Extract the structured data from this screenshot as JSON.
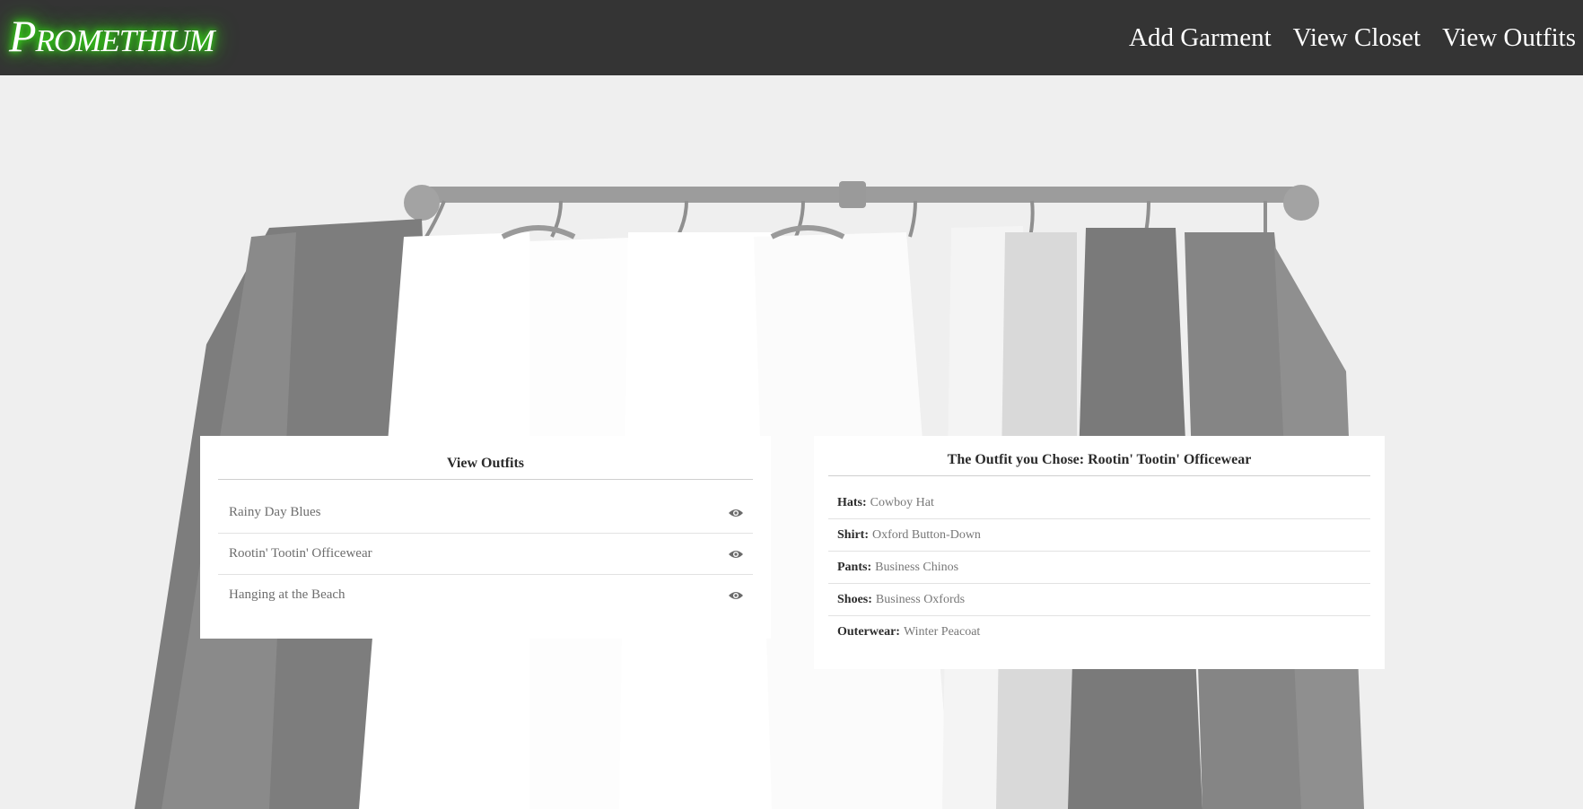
{
  "brand": {
    "name": "Promethium",
    "glow_color": "#39ff14"
  },
  "nav": {
    "links": [
      {
        "label": "Add Garment"
      },
      {
        "label": "View Closet"
      },
      {
        "label": "View Outfits"
      }
    ]
  },
  "outfits_panel": {
    "title": "View Outfits",
    "items": [
      {
        "name": "Rainy Day Blues",
        "icon": "eye-icon"
      },
      {
        "name": "Rootin' Tootin' Officewear",
        "icon": "eye-icon"
      },
      {
        "name": "Hanging at the Beach",
        "icon": "eye-icon"
      }
    ]
  },
  "detail_panel": {
    "title": "The Outfit you Chose: Rootin' Tootin' Officewear",
    "items": [
      {
        "key": "Hats:",
        "value": "Cowboy Hat"
      },
      {
        "key": "Shirt:",
        "value": "Oxford Button-Down"
      },
      {
        "key": "Pants:",
        "value": "Business Chinos"
      },
      {
        "key": "Shoes:",
        "value": "Business Oxfords"
      },
      {
        "key": "Outerwear:",
        "value": "Winter Peacoat"
      }
    ]
  },
  "colors": {
    "navbar": "#343434",
    "background": "#f0f0f0",
    "card": "#ffffff"
  }
}
